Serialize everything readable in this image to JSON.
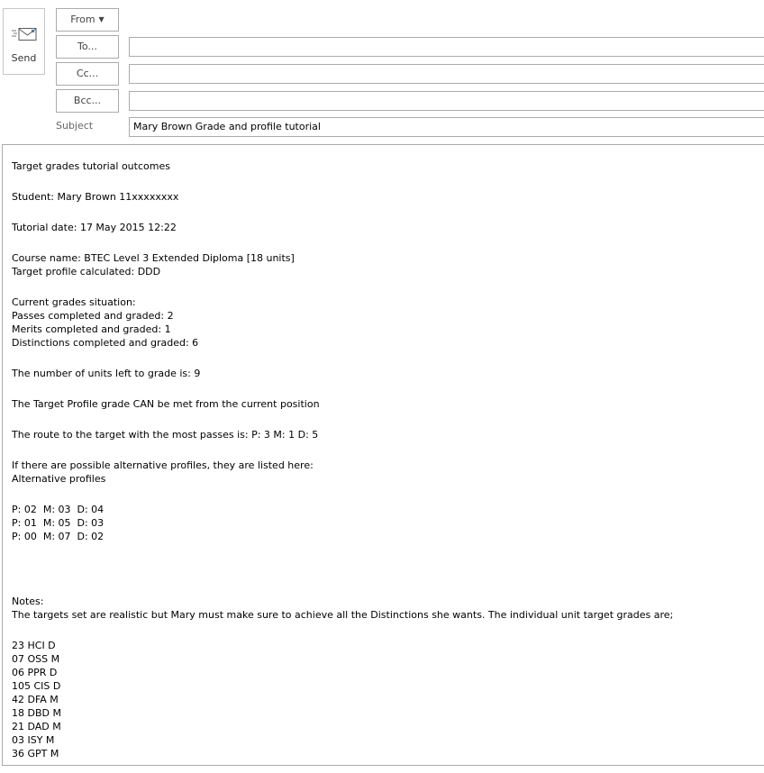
{
  "compose": {
    "send_label": "Send",
    "from_label": "From",
    "from_value": "",
    "to_label": "To...",
    "to_value": "",
    "cc_label": "Cc...",
    "cc_value": "",
    "bcc_label": "Bcc...",
    "bcc_value": "",
    "subject_label": "Subject",
    "subject_value": "Mary Brown Grade and profile tutorial"
  },
  "icons": {
    "send": "send-envelope-icon",
    "from_dropdown": "chevron-down-icon"
  },
  "body": {
    "title": "Target grades tutorial outcomes",
    "student": "Student: Mary Brown 11xxxxxxxx",
    "tutorial_date": "Tutorial date: 17 May 2015 12:22",
    "course_name": "Course name: BTEC Level 3 Extended Diploma [18 units]",
    "target_profile": "Target profile calculated: DDD",
    "current_heading": "Current grades situation:",
    "passes": "Passes completed and graded: 2",
    "merits": "Merits completed and graded: 1",
    "distinctions": "Distinctions completed and graded: 6",
    "units_left": "The number of units left to grade is: 9",
    "can_be_met": "The Target Profile grade CAN be met from the current position",
    "route": "The route to the target with the most passes is: P: 3 M: 1 D: 5",
    "alternatives_intro": "If there are possible alternative profiles, they are listed here:",
    "alternatives_heading": "Alternative profiles",
    "alternatives": [
      "P: 02  M: 03  D: 04",
      "P: 01  M: 05  D: 03",
      "P: 00  M: 07  D: 02"
    ],
    "notes_label": "Notes:",
    "notes_text": "The targets set are realistic but Mary must make sure to achieve all the Distinctions she wants. The individual unit target grades are;",
    "unit_targets": [
      "23 HCI D",
      "07 OSS M",
      "06 PPR D",
      "105 CIS D",
      "42 DFA M",
      "18 DBD M",
      "21 DAD M",
      "03 ISY M",
      "36 GPT M"
    ]
  }
}
